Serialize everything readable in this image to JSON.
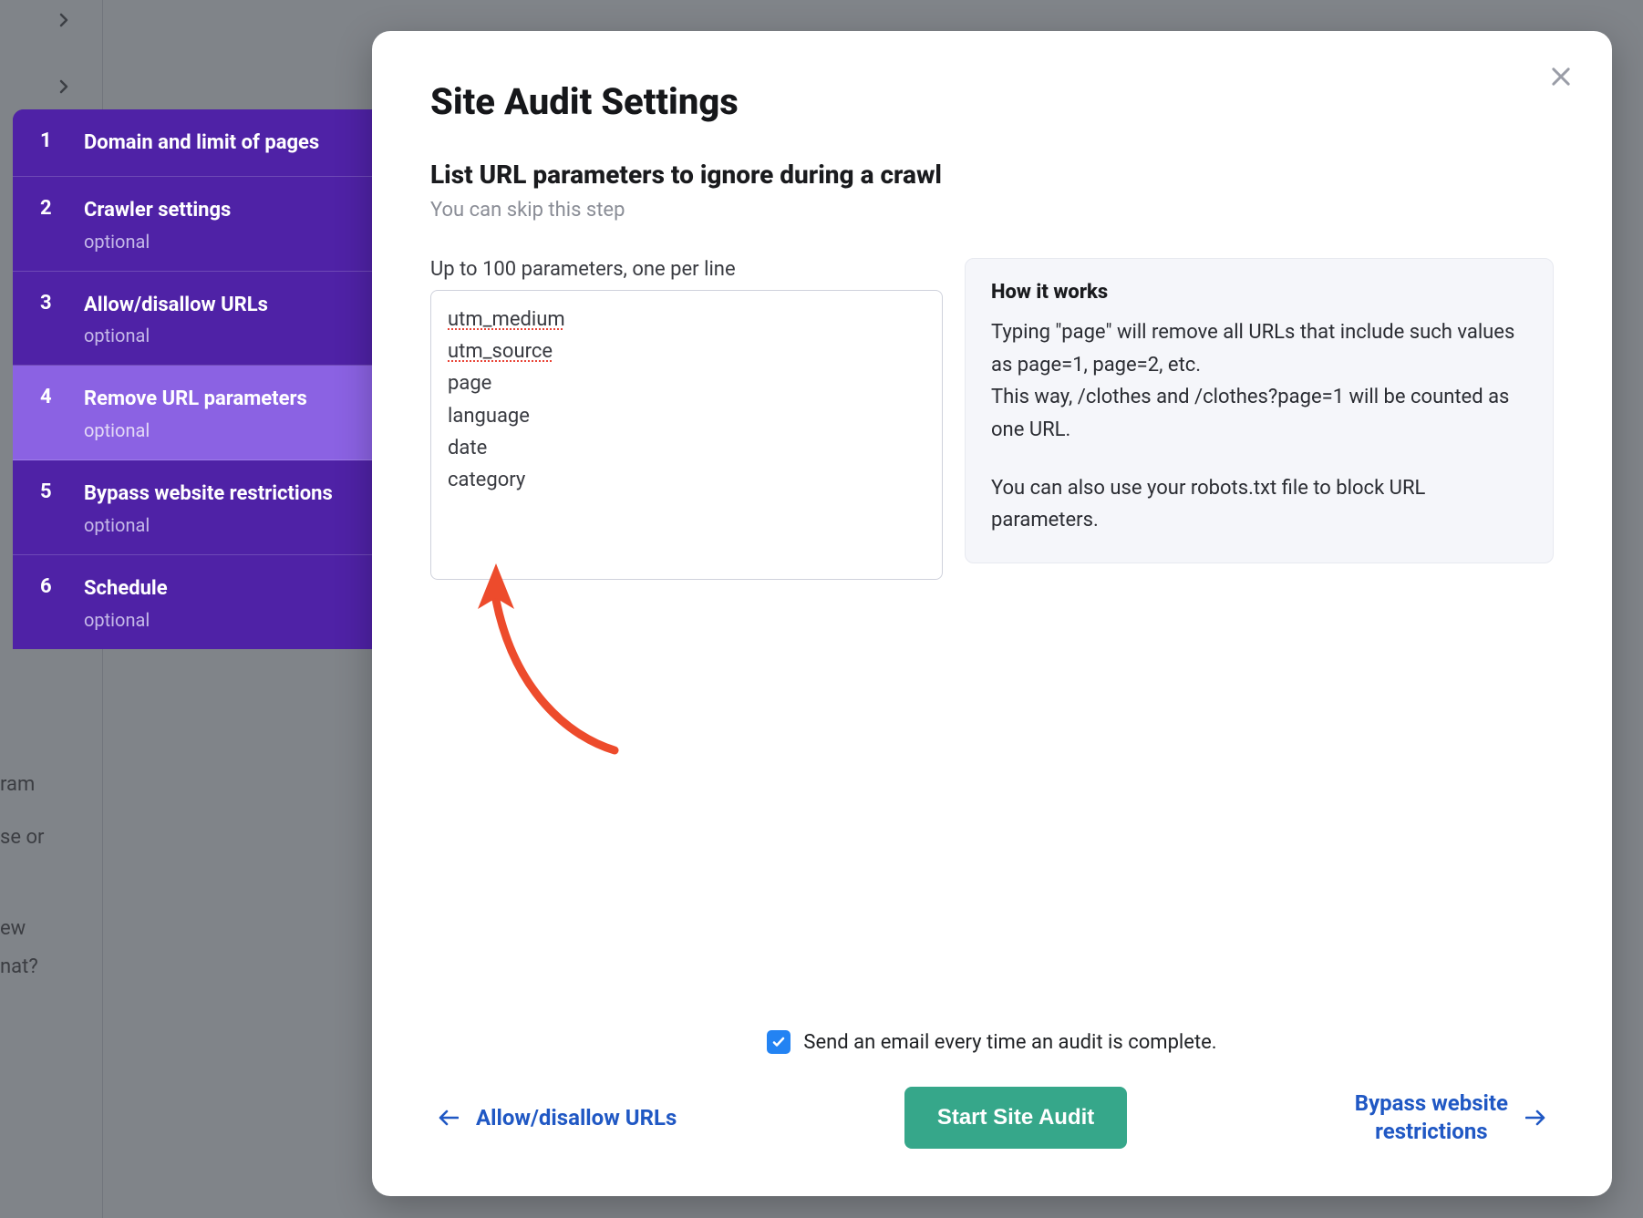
{
  "sidebar": {
    "items": [
      {
        "number": "1",
        "label": "Domain and limit of pages",
        "optional": false
      },
      {
        "number": "2",
        "label": "Crawler settings",
        "optional": true
      },
      {
        "number": "3",
        "label": "Allow/disallow URLs",
        "optional": true
      },
      {
        "number": "4",
        "label": "Remove URL parameters",
        "optional": true,
        "active": true
      },
      {
        "number": "5",
        "label": "Bypass website restrictions",
        "optional": true
      },
      {
        "number": "6",
        "label": "Schedule",
        "optional": true
      }
    ],
    "optional_text": "optional"
  },
  "modal": {
    "title": "Site Audit Settings",
    "section": {
      "heading": "List URL parameters to ignore during a crawl",
      "sub": "You can skip this step"
    },
    "params": {
      "hint": "Up to 100 parameters, one per line",
      "value_lines": [
        "utm_medium",
        "utm_source",
        "page",
        "language",
        "date",
        "category"
      ]
    },
    "info": {
      "title": "How it works",
      "p1": "Typing \"page\" will remove all URLs that include such values as page=1, page=2, etc.",
      "p2": "This way, /clothes and /clothes?page=1 will be counted as one URL.",
      "p3": "You can also use your robots.txt file to block URL parameters."
    },
    "footer": {
      "email_checkbox_checked": true,
      "email_text": "Send an email every time an audit is complete.",
      "prev": "Allow/disallow URLs",
      "start": "Start Site Audit",
      "next_line1": "Bypass website",
      "next_line2": "restrictions"
    }
  },
  "background": {
    "t1": "ram",
    "t2": "se or",
    "t3": "ew",
    "t4": "nat?"
  }
}
